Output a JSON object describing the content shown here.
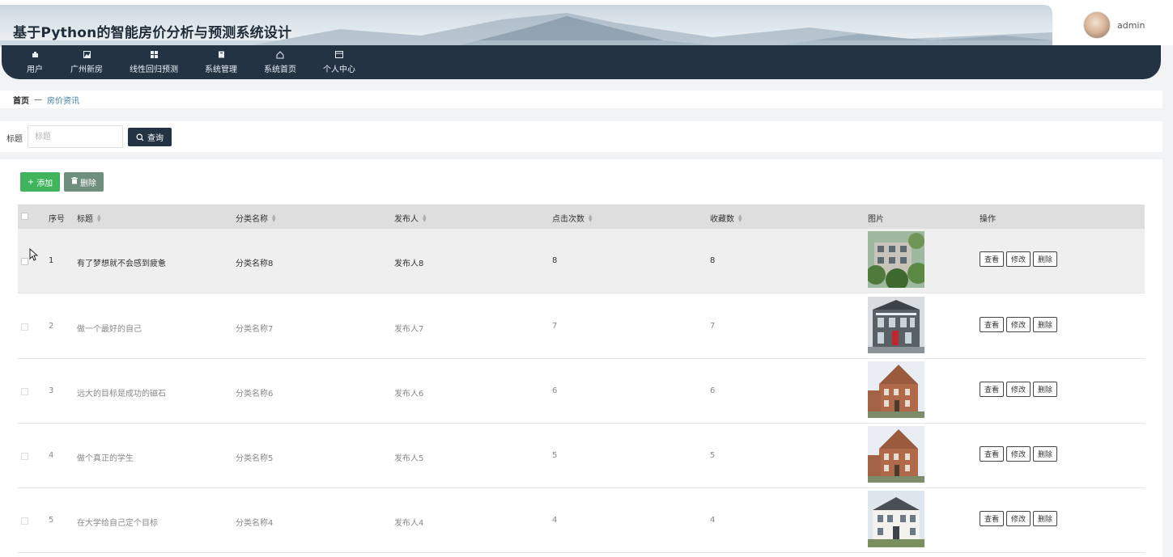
{
  "app": {
    "title": "基于Python的智能房价分析与预测系统设计",
    "username": "admin"
  },
  "nav": [
    {
      "label": "用户",
      "icon": "user-icon"
    },
    {
      "label": "广州新房",
      "icon": "image-icon"
    },
    {
      "label": "线性回归预测",
      "icon": "grid-icon"
    },
    {
      "label": "系统管理",
      "icon": "book-icon"
    },
    {
      "label": "系统首页",
      "icon": "home-icon"
    },
    {
      "label": "个人中心",
      "icon": "card-icon"
    }
  ],
  "breadcrumb": {
    "home": "首页",
    "separator": "—",
    "current": "房价资讯"
  },
  "search": {
    "label": "标题",
    "placeholder": "标题",
    "button": "查询"
  },
  "toolbar": {
    "add": "添加",
    "delete": "删除"
  },
  "table": {
    "columns": {
      "index": "序号",
      "title": "标题",
      "category": "分类名称",
      "publisher": "发布人",
      "clicks": "点击次数",
      "favorites": "收藏数",
      "image": "图片",
      "actions": "操作"
    },
    "rows": [
      {
        "index": "1",
        "title": "有了梦想就不会感到疲惫",
        "category": "分类名称8",
        "publisher": "发布人8",
        "clicks": "8",
        "favorites": "8",
        "image": "green-house-photo"
      },
      {
        "index": "2",
        "title": "做一个最好的自己",
        "category": "分类名称7",
        "publisher": "发布人7",
        "clicks": "7",
        "favorites": "7",
        "image": "gray-house-photo"
      },
      {
        "index": "3",
        "title": "远大的目标是成功的磁石",
        "category": "分类名称6",
        "publisher": "发布人6",
        "clicks": "6",
        "favorites": "6",
        "image": "brick-house-photo"
      },
      {
        "index": "4",
        "title": "做个真正的学生",
        "category": "分类名称5",
        "publisher": "发布人5",
        "clicks": "5",
        "favorites": "5",
        "image": "brick-house-photo"
      },
      {
        "index": "5",
        "title": "在大学给自己定个目标",
        "category": "分类名称4",
        "publisher": "发布人4",
        "clicks": "4",
        "favorites": "4",
        "image": "white-house-photo"
      }
    ],
    "row_actions": {
      "view": "查看",
      "edit": "修改",
      "delete": "删除"
    }
  },
  "colors": {
    "nav_bg": "#243344",
    "add_green": "#3fb45c",
    "delete_green": "#6e8f7b",
    "link_blue": "#3a7fb8"
  }
}
